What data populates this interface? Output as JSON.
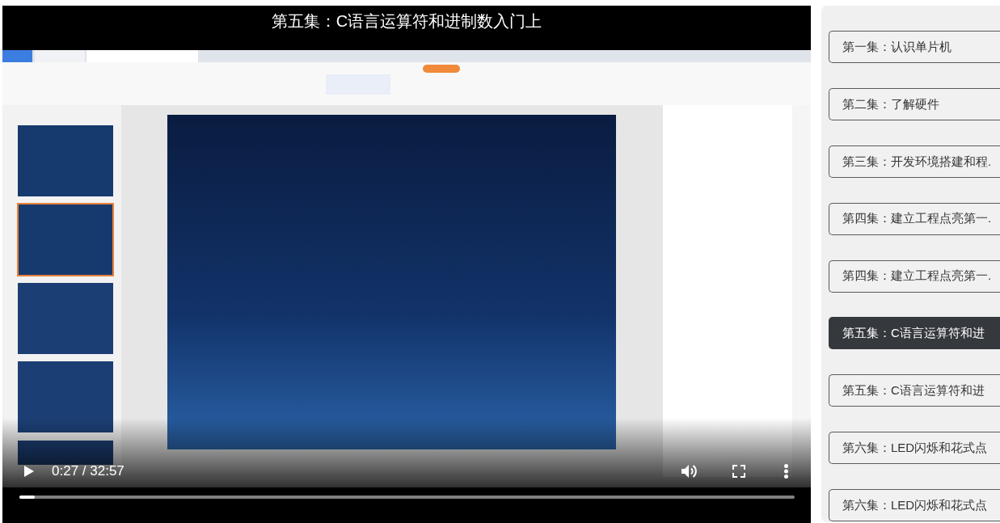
{
  "player": {
    "title": "第五集：C语言运算符和进制数入门上",
    "playing": false,
    "time": "0:27 / 32:57",
    "muted": false,
    "progress": {
      "level": 0.02
    }
  },
  "playlist": {
    "episodes": [
      {
        "label": "第一集：认识单片机",
        "selected": false
      },
      {
        "label": "第二集：了解硬件",
        "selected": false
      },
      {
        "label": "第三集：开发环境搭建和程.",
        "selected": false
      },
      {
        "label": "第四集：建立工程点亮第一.",
        "selected": false
      },
      {
        "label": "第四集：建立工程点亮第一.",
        "selected": false
      },
      {
        "label": "第五集：C语言运算符和进",
        "selected": true
      },
      {
        "label": "第五集：C语言运算符和进",
        "selected": false
      },
      {
        "label": "第六集：LED闪烁和花式点",
        "selected": false
      },
      {
        "label": "第六集：LED闪烁和花式点",
        "selected": false
      }
    ]
  }
}
